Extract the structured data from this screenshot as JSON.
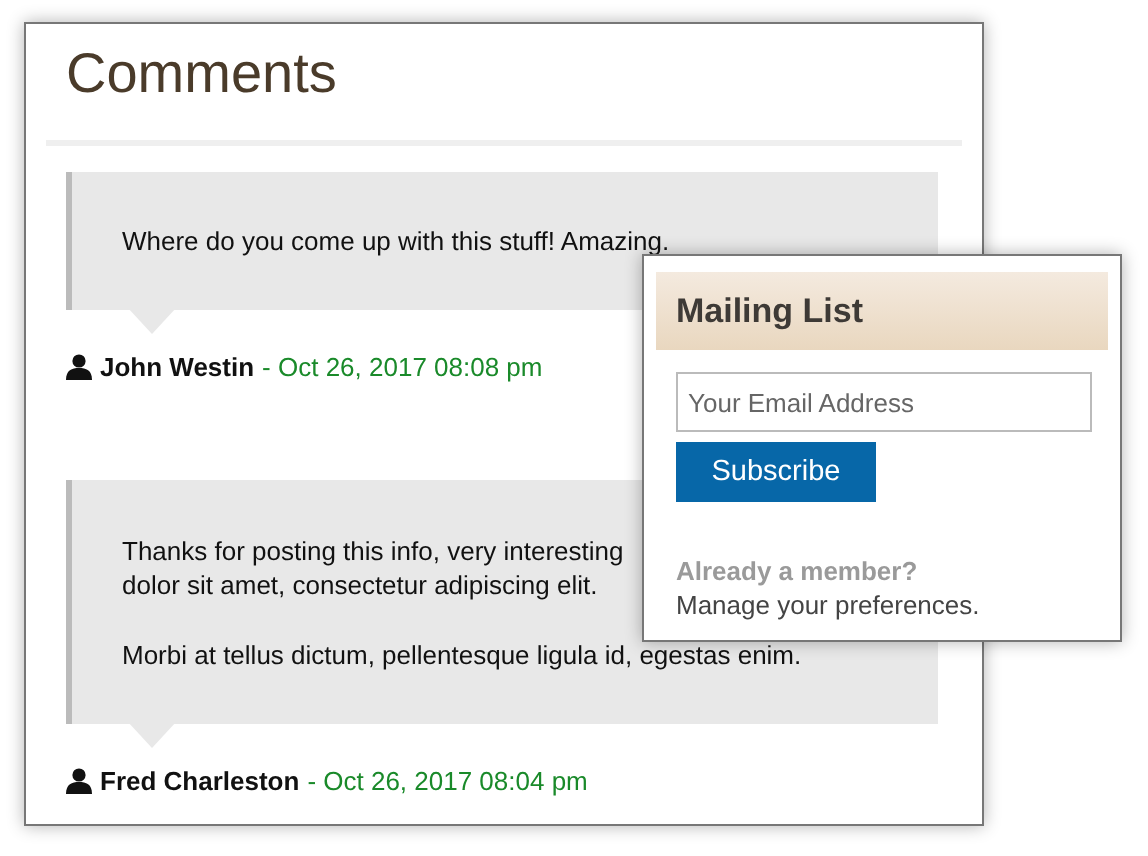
{
  "heading": "Comments",
  "comments": [
    {
      "paragraphs": [
        [
          "Where do you come up with this stuff! Amazing."
        ]
      ],
      "author": "John Westin",
      "date": "- Oct 26, 2017 08:08 pm"
    },
    {
      "paragraphs": [
        [
          "Thanks for posting this info, very interesting",
          "dolor sit amet, consectetur adipiscing elit."
        ],
        [
          "Morbi at tellus dictum, pellentesque ligula id, egestas enim."
        ]
      ],
      "author": "Fred Charleston",
      "date": "- Oct 26, 2017 08:04 pm"
    }
  ],
  "mailing_list": {
    "title": "Mailing List",
    "email": {
      "placeholder": "Your Email Address"
    },
    "button": "Subscribe",
    "member_prompt": "Already a member?",
    "manage_link": "Manage your preferences."
  }
}
